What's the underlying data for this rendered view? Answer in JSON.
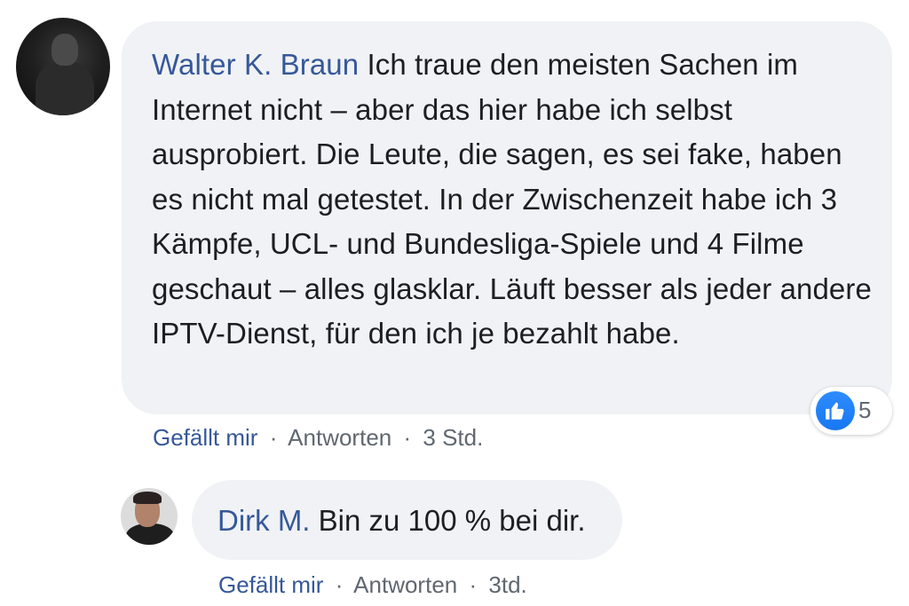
{
  "main_comment": {
    "author": "Walter K. Braun",
    "text": "Ich traue den meisten Sachen im Internet nicht – aber das hier habe ich selbst ausprobiert. Die Leute, die sagen, es sei fake, haben es nicht mal getestet. In der Zwischenzeit habe ich 3 Kämpfe, UCL- und Bundesliga-Spiele und 4 Filme geschaut – alles glasklar. Läuft besser als jeder andere IPTV-Dienst, für den ich je bezahlt habe.",
    "reaction_count": "5",
    "actions": {
      "like_label": "Gefällt mir",
      "reply_label": "Antworten",
      "separator": "·",
      "timestamp": "3 Std."
    }
  },
  "reply": {
    "author": "Dirk M.",
    "text": "Bin zu 100 % bei dir.",
    "actions": {
      "like_label": "Gefällt mir",
      "reply_label": "Antworten",
      "separator": "·",
      "timestamp": "3td."
    }
  },
  "icons": {
    "reaction": "like-thumbs-up-icon"
  },
  "colors": {
    "author_link": "#365899",
    "bubble_background": "#f0f2f5",
    "like_blue": "#1877f2",
    "meta_text": "#606770"
  }
}
